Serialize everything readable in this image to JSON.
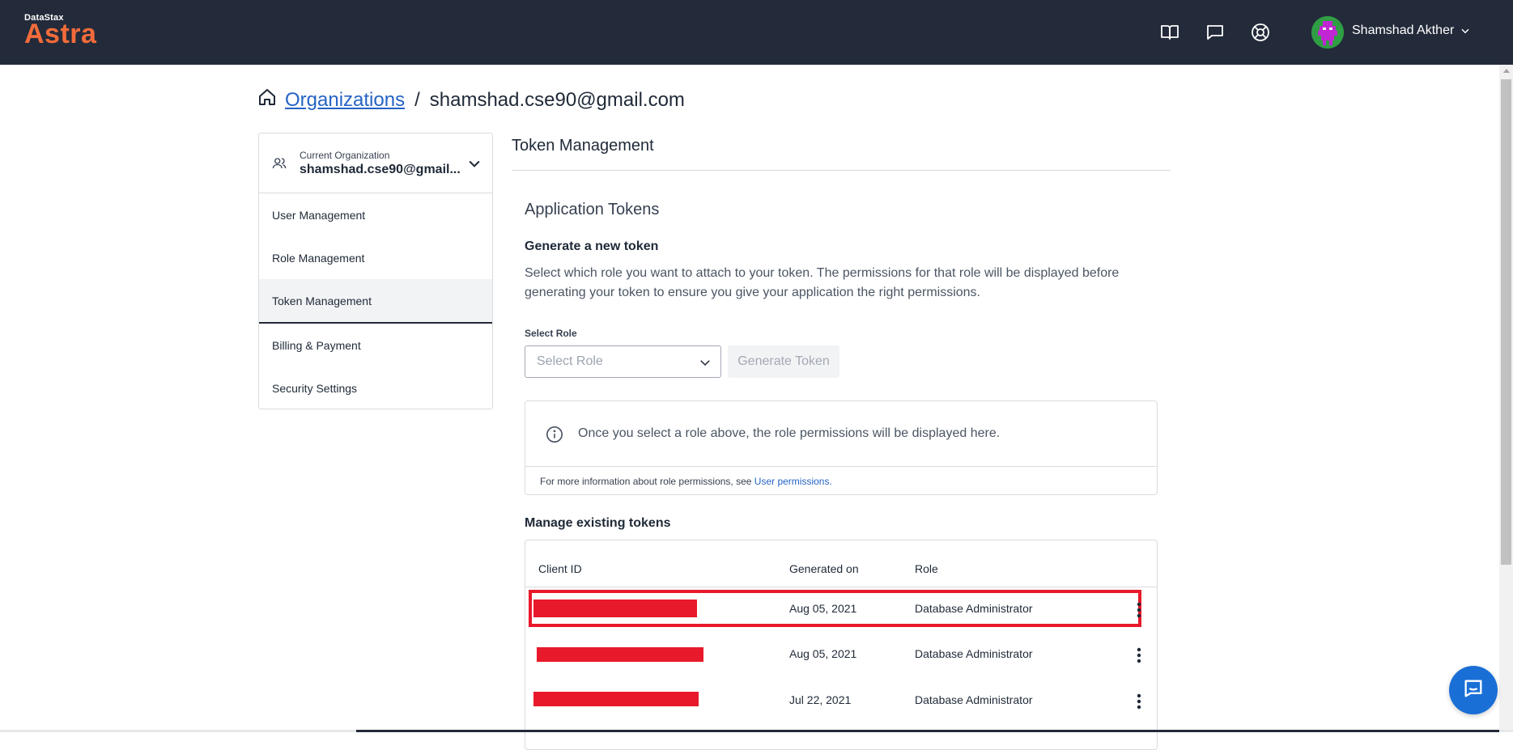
{
  "header": {
    "logo_small": "DataStax",
    "logo_big": "Astra",
    "icons": [
      "book-icon",
      "chat-icon",
      "help-lifebuoy-icon"
    ],
    "user_name": "Shamshad Akther"
  },
  "breadcrumb": {
    "link": "Organizations",
    "separator": "/",
    "current": "shamshad.cse90@gmail.com"
  },
  "sidebar": {
    "org_label": "Current Organization",
    "org_name": "shamshad.cse90@gmail...",
    "items": [
      {
        "label": "User Management"
      },
      {
        "label": "Role Management"
      },
      {
        "label": "Token Management",
        "active": true
      },
      {
        "label": "Billing & Payment"
      },
      {
        "label": "Security Settings"
      }
    ]
  },
  "main": {
    "title": "Token Management",
    "section_title": "Application Tokens",
    "generate_title": "Generate a new token",
    "generate_desc": "Select which role you want to attach to your token. The permissions for that role will be displayed before generating your token to ensure you give your application the right permissions.",
    "select_label": "Select Role",
    "select_placeholder": "Select Role",
    "generate_button": "Generate Token",
    "info_text": "Once you select a role above, the role permissions will be displayed here.",
    "info_foot_prefix": "For more information about role permissions, see ",
    "info_foot_link": "User permissions.",
    "manage_title": "Manage existing tokens",
    "table": {
      "headers": [
        "Client ID",
        "Generated on",
        "Role"
      ],
      "rows": [
        {
          "client_id": "",
          "generated_on": "Aug 05, 2021",
          "role": "Database Administrator",
          "highlighted": true
        },
        {
          "client_id": "",
          "generated_on": "Aug 05, 2021",
          "role": "Database Administrator"
        },
        {
          "client_id": "",
          "generated_on": "Jul 22, 2021",
          "role": "Database Administrator"
        }
      ]
    }
  },
  "colors": {
    "topbar": "#232b3a",
    "brand": "#f26b3a",
    "link": "#2563c4",
    "redaction": "#e8192a",
    "chat_button": "#1a6fd6"
  }
}
